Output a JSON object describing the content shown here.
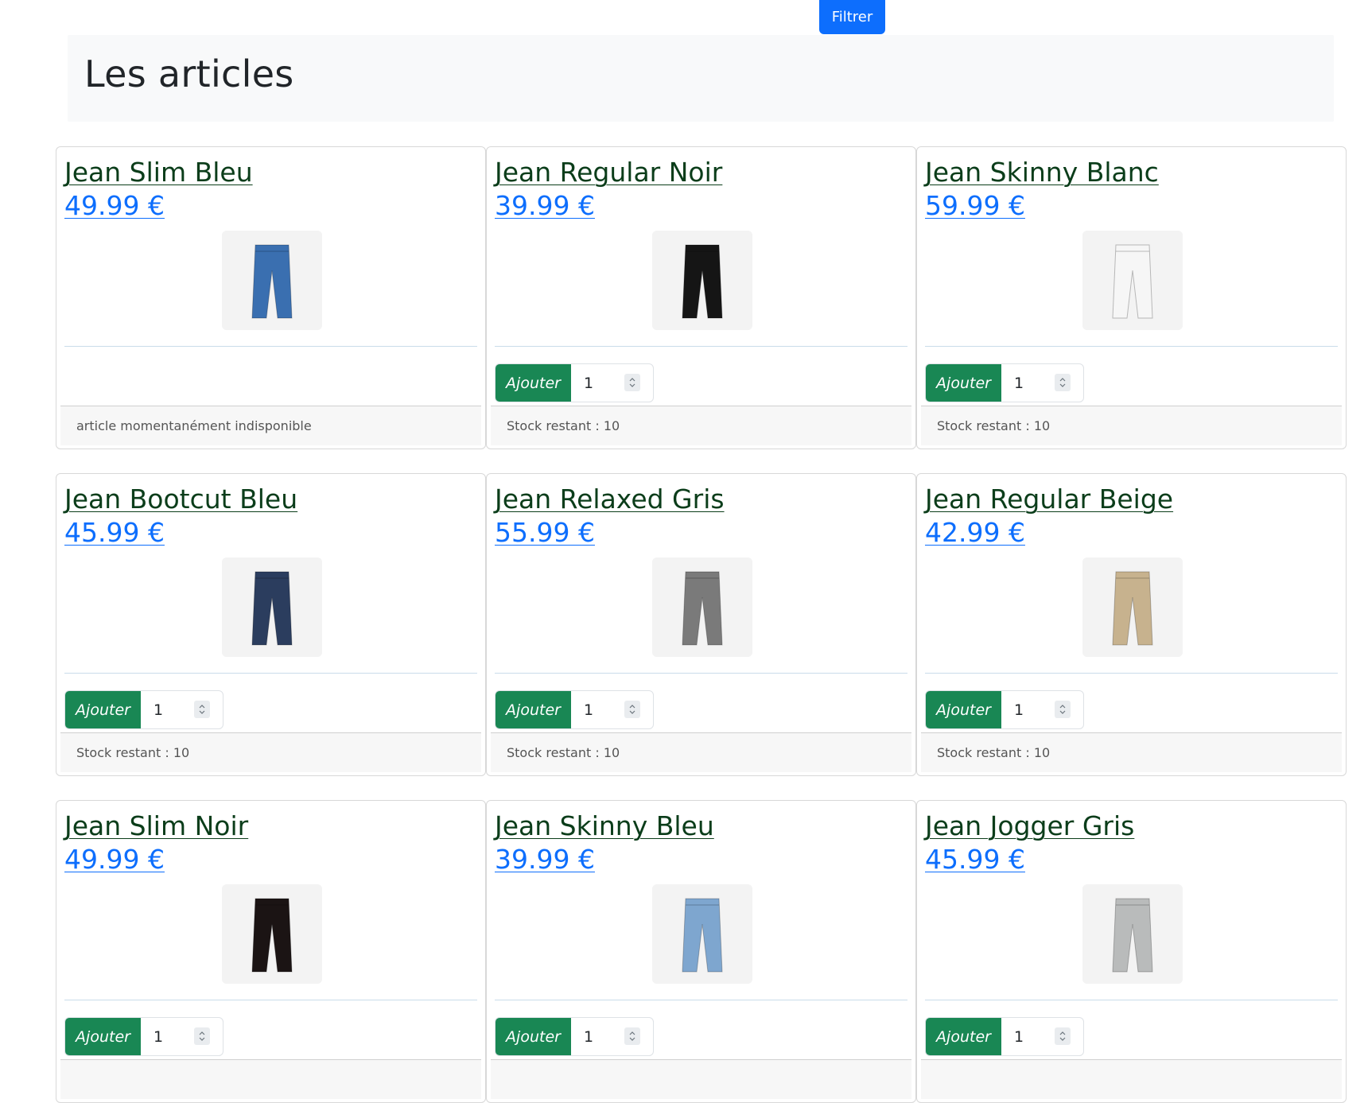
{
  "filter_button": {
    "label": "Filtrer"
  },
  "header": {
    "title": "Les articles"
  },
  "add_label": "Ajouter",
  "articles": [
    {
      "name": "Jean Slim Bleu",
      "price": "49.99 €",
      "available": false,
      "quantity": "1",
      "status": "article momentanément indisponible",
      "image": "jean-slim-bleu-photo",
      "color": "#3a6fb0"
    },
    {
      "name": "Jean Regular Noir",
      "price": "39.99 €",
      "available": true,
      "quantity": "1",
      "status": "Stock restant : 10",
      "image": "jean-regular-noir-photo",
      "color": "#151515"
    },
    {
      "name": "Jean Skinny Blanc",
      "price": "59.99 €",
      "available": true,
      "quantity": "1",
      "status": "Stock restant : 10",
      "image": "jean-skinny-blanc-photo",
      "color": "#f6f6f6"
    },
    {
      "name": "Jean Bootcut Bleu",
      "price": "45.99 €",
      "available": true,
      "quantity": "1",
      "status": "Stock restant : 10",
      "image": "jean-bootcut-bleu-photo",
      "color": "#2b3d5e"
    },
    {
      "name": "Jean Relaxed Gris",
      "price": "55.99 €",
      "available": true,
      "quantity": "1",
      "status": "Stock restant : 10",
      "image": "jean-relaxed-gris-photo",
      "color": "#7a7a7a"
    },
    {
      "name": "Jean Regular Beige",
      "price": "42.99 €",
      "available": true,
      "quantity": "1",
      "status": "Stock restant : 10",
      "image": "jean-regular-beige-photo",
      "color": "#c7b28e"
    },
    {
      "name": "Jean Slim Noir",
      "price": "49.99 €",
      "available": true,
      "quantity": "1",
      "status": "",
      "image": "jean-slim-noir-photo",
      "color": "#1b1414"
    },
    {
      "name": "Jean Skinny Bleu",
      "price": "39.99 €",
      "available": true,
      "quantity": "1",
      "status": "",
      "image": "jean-skinny-bleu-photo",
      "color": "#7ea6cf"
    },
    {
      "name": "Jean Jogger Gris",
      "price": "45.99 €",
      "available": true,
      "quantity": "1",
      "status": "",
      "image": "jean-jogger-gris-photo",
      "color": "#b9bbbb"
    }
  ],
  "colors": {
    "primary": "#0d6efd",
    "success": "#198754",
    "title_link": "#0b3d1a",
    "header_bg": "#f8f9fa"
  }
}
